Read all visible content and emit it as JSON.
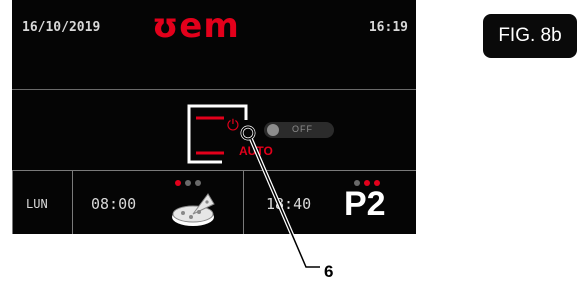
{
  "header": {
    "date": "16/10/2019",
    "logo": "ʊem",
    "time": "16:19"
  },
  "program_mode": {
    "auto_label": "AUTO",
    "power_icon": "power-icon",
    "toggle_label": "OFF"
  },
  "schedule_row": {
    "day": "LUN",
    "start_time": "08:00",
    "end_time": "18:40",
    "program": "P2",
    "left_icon": "pizza-icon"
  },
  "figure": {
    "label": "FIG. 8b",
    "callout_number": "6"
  },
  "colors": {
    "accent": "#e3001b",
    "screen_bg": "#050505"
  }
}
